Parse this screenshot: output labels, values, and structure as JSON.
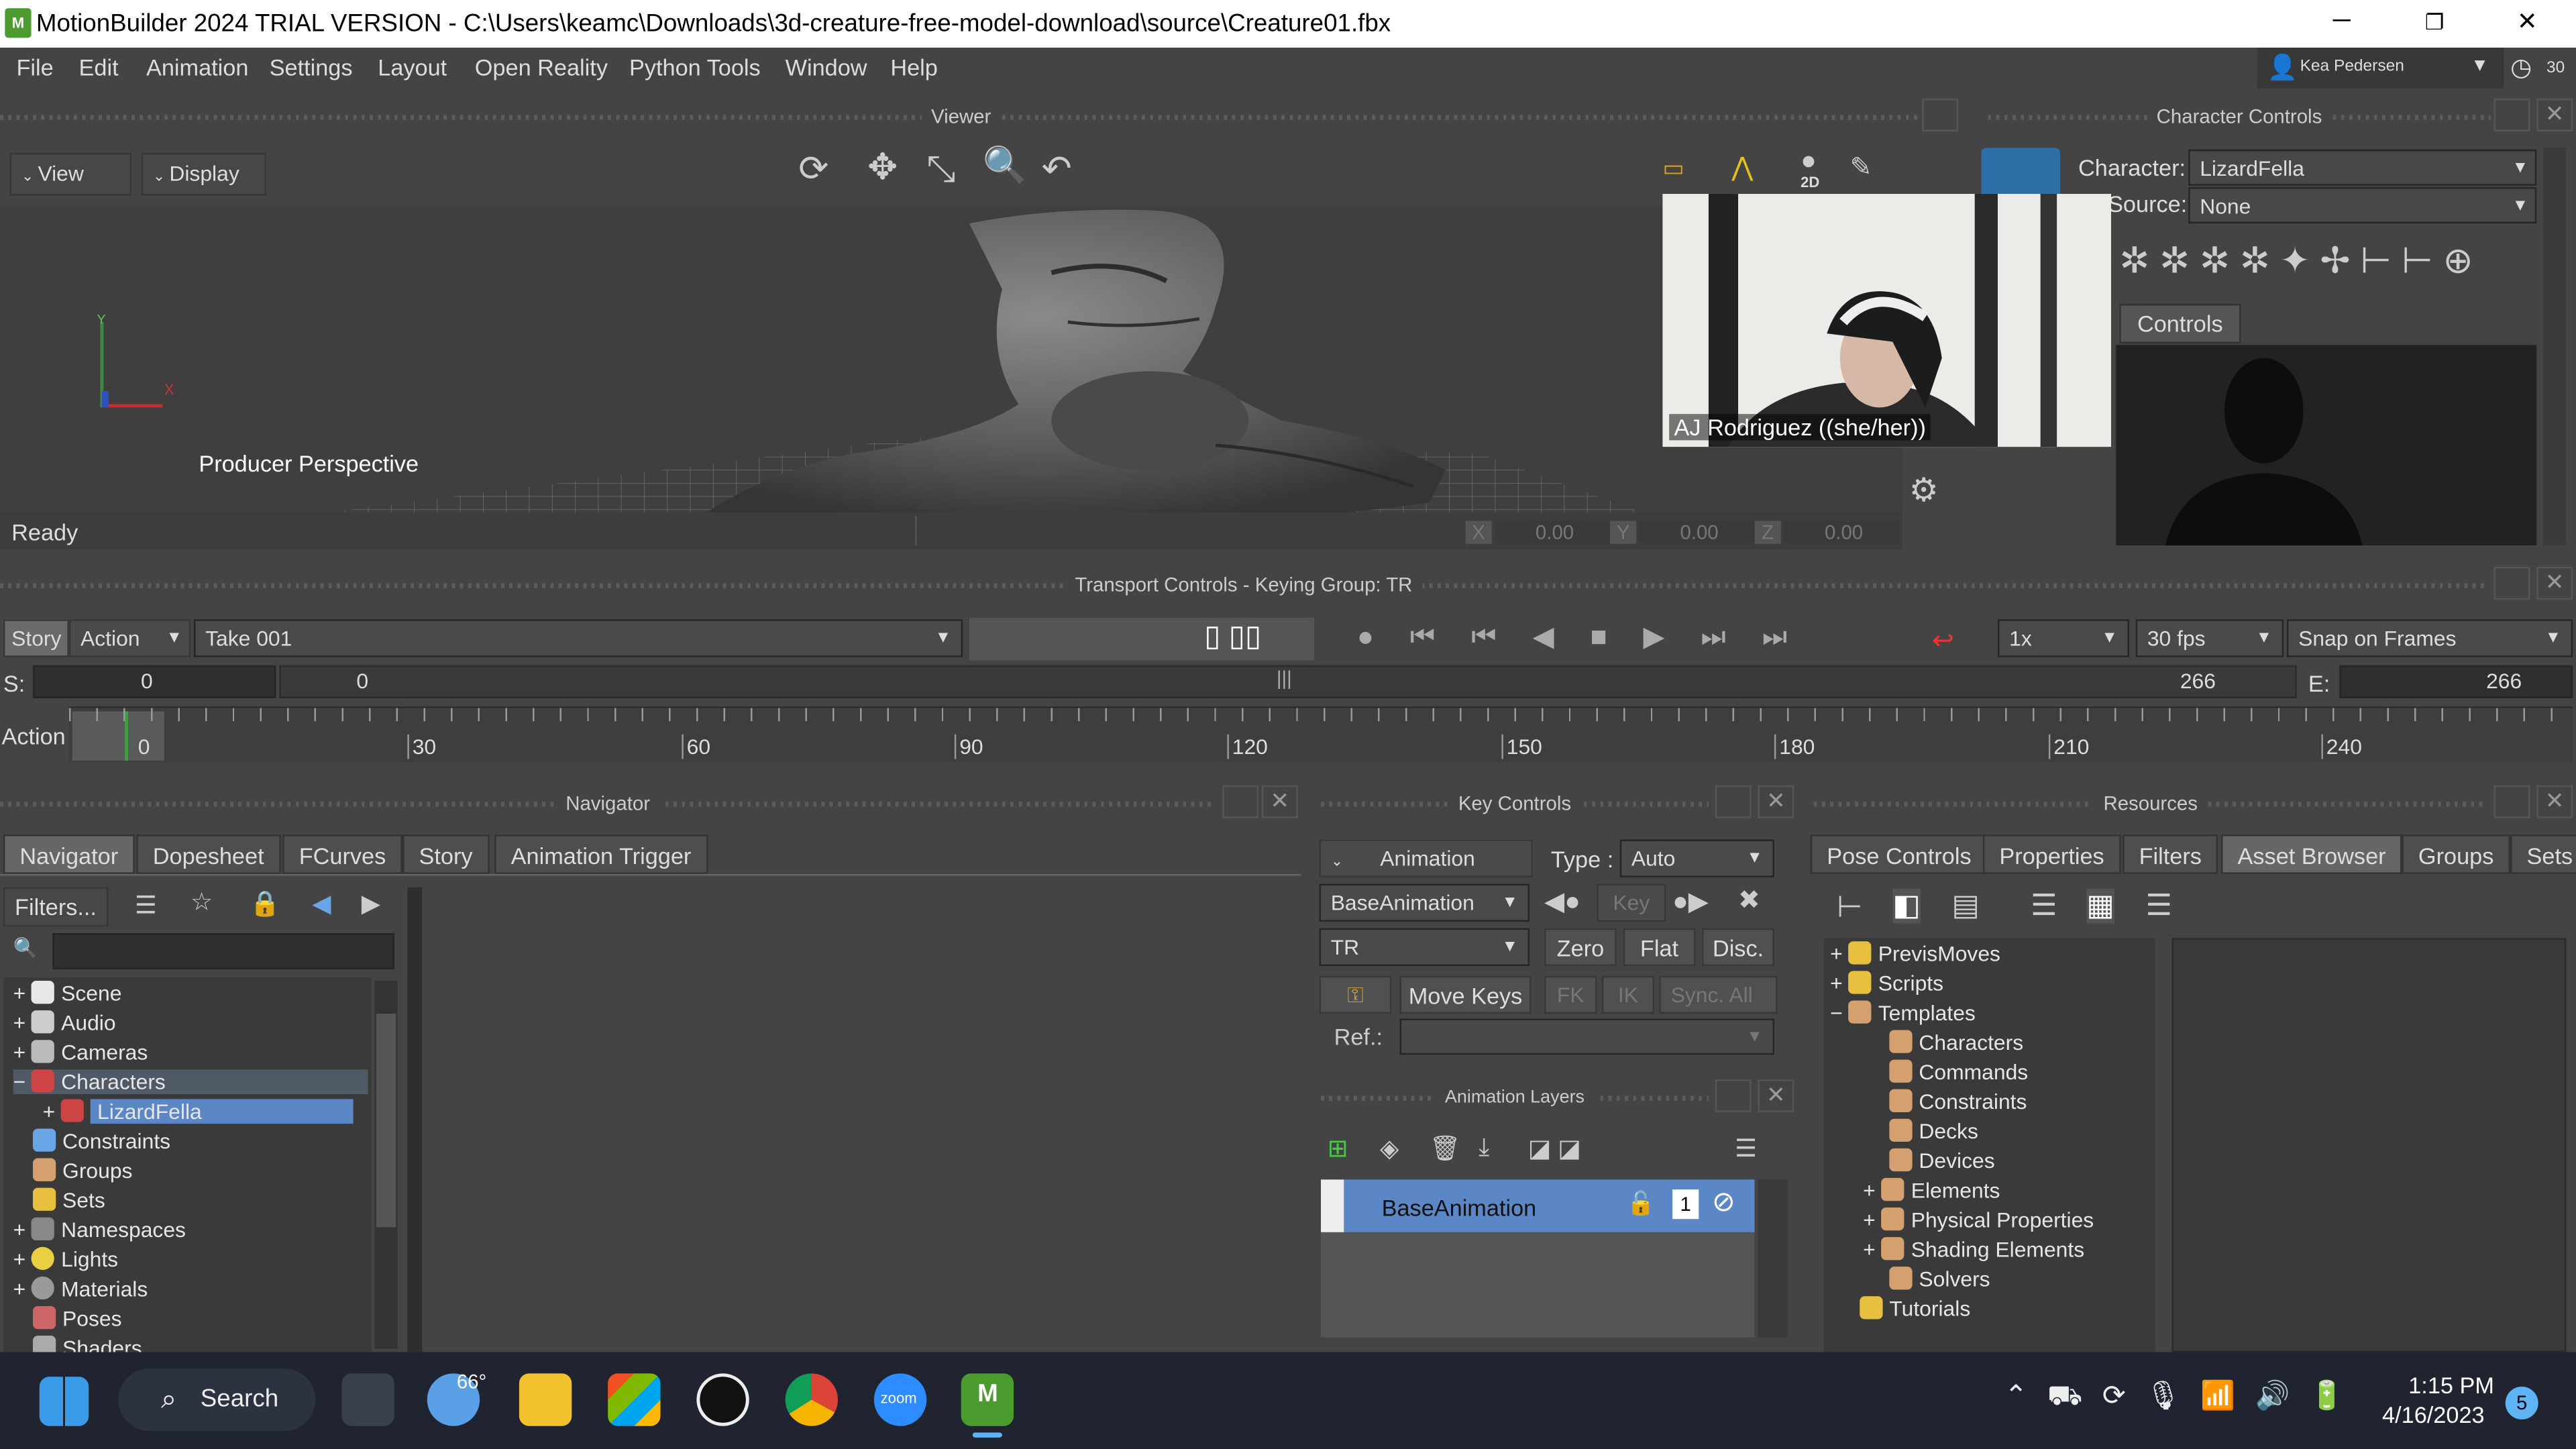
{
  "window": {
    "title": "MotionBuilder 2024 TRIAL VERSION - C:\\Users\\keamc\\Downloads\\3d-creature-free-model-download\\source\\Creature01.fbx",
    "app_icon": "M",
    "minimize": "─",
    "restore": "❐",
    "close": "✕"
  },
  "menu": [
    "File",
    "Edit",
    "Animation",
    "Settings",
    "Layout",
    "Open Reality",
    "Python Tools",
    "Window",
    "Help"
  ],
  "user": {
    "name": "Kea Pedersen",
    "badge": "30"
  },
  "viewer": {
    "header": "Viewer",
    "view_btn": "View",
    "display_btn": "Display",
    "camera_label": "Producer Perspective",
    "status": "Ready",
    "x_label": "X",
    "x_val": "0.00",
    "y_label": "Y",
    "y_val": "0.00",
    "z_label": "Z",
    "z_val": "0.00",
    "axis_x": "X",
    "axis_y": "Y",
    "badge_2d": "2D"
  },
  "video": {
    "participant": "AJ Rodriguez ((she/her))"
  },
  "character_controls": {
    "header": "Character Controls",
    "character_label": "Character:",
    "character_value": "LizardFella",
    "source_label": "Source:",
    "source_value": "None",
    "controls_tab": "Controls"
  },
  "transport": {
    "header": "Transport Controls  -  Keying Group: TR",
    "story_btn": "Story",
    "action_btn": "Action",
    "take": "Take 001",
    "speed": "1x",
    "fps": "30 fps",
    "snap": "Snap on Frames",
    "s_label": "S:",
    "s_val": "0",
    "cur": "0",
    "end_cur": "266",
    "e_label": "E:",
    "e_val": "266",
    "action_label": "Action",
    "ticks": [
      "0",
      "30",
      "60",
      "90",
      "120",
      "150",
      "180",
      "210",
      "240"
    ]
  },
  "navigator": {
    "header": "Navigator",
    "tabs": [
      "Navigator",
      "Dopesheet",
      "FCurves",
      "Story",
      "Animation Trigger"
    ],
    "filters": "Filters...",
    "items": [
      "Scene",
      "Audio",
      "Cameras",
      "Characters",
      "LizardFella",
      "Constraints",
      "Groups",
      "Sets",
      "Namespaces",
      "Lights",
      "Materials",
      "Poses",
      "Shaders"
    ]
  },
  "key_controls": {
    "header": "Key Controls",
    "animation": "Animation",
    "type_label": "Type :",
    "type_value": "Auto",
    "layer": "BaseAnimation",
    "key": "Key",
    "group": "TR",
    "zero": "Zero",
    "flat": "Flat",
    "disc": "Disc.",
    "move_keys": "Move Keys",
    "fk": "FK",
    "ik": "IK",
    "sync": "Sync. All",
    "ref": "Ref.:",
    "layers_header": "Animation Layers",
    "base_layer": "BaseAnimation",
    "layer_badge": "1"
  },
  "resources": {
    "header": "Resources",
    "tabs": [
      "Pose Controls",
      "Properties",
      "Filters",
      "Asset Browser",
      "Groups",
      "Sets"
    ],
    "items": [
      "PrevisMoves",
      "Scripts",
      "Templates",
      "Characters",
      "Commands",
      "Constraints",
      "Decks",
      "Devices",
      "Elements",
      "Physical Properties",
      "Shading Elements",
      "Solvers",
      "Tutorials"
    ]
  },
  "taskbar": {
    "search": "Search",
    "weather": "66°",
    "time": "1:15 PM",
    "date": "4/16/2023",
    "notif": "5",
    "zoom": "zoom",
    "mb": "M"
  }
}
